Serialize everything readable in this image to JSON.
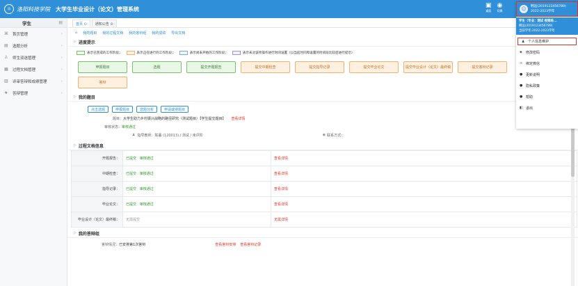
{
  "header": {
    "logo_glyph": "☼",
    "school_name": "洛阳科技学院",
    "system_title": "大学生毕业设计（论文）管理系统",
    "icons": [
      {
        "name": "monitor-icon",
        "glyph": "▣",
        "label": "桌面"
      },
      {
        "name": "globe-icon",
        "glyph": "◉",
        "label": "切换"
      }
    ]
  },
  "sidebar": {
    "role": "学生",
    "items": [
      {
        "name": "sidebar-item-home",
        "icon": "⌘",
        "label": "首页管理"
      },
      {
        "name": "sidebar-item-topic",
        "icon": "▤",
        "label": "选题分析"
      },
      {
        "name": "sidebar-item-choose",
        "icon": "♙",
        "label": "师生双选管理"
      },
      {
        "name": "sidebar-item-docs",
        "icon": "▦",
        "label": "过程文档管理"
      },
      {
        "name": "sidebar-item-review",
        "icon": "▥",
        "label": "评审答辩和成绩管理"
      },
      {
        "name": "sidebar-item-defense",
        "icon": "★",
        "label": "答辩管理"
      }
    ]
  },
  "tabs": [
    {
      "label": "首页 ⊙"
    },
    {
      "label": "通知公告 ⊙"
    }
  ],
  "links": [
    "我的题目",
    "我的过程文档",
    "我的答辩组",
    "我的成绩",
    "导出文档"
  ],
  "progress": {
    "title": "进度提示",
    "legend": [
      {
        "color": "#78c06a",
        "fill": "#e9f7e6",
        "text": "表示已完成的工作阶段；"
      },
      {
        "color": "#f0b070",
        "fill": "#fff0e0",
        "text": "表示正在进行的工作阶段；"
      },
      {
        "color": "#7aa7d8",
        "fill": "#eef4fb",
        "text": "表示尚未开始的工作阶段；"
      },
      {
        "color": "#a88fd0",
        "fill": "#f3effa",
        "text": "表示未对该项操作进行时间设置（以当前时间和设置的时间段比较后进行提示）"
      }
    ],
    "stages_row1": [
      {
        "label": "申报题目",
        "state": "done"
      },
      {
        "label": "选题",
        "state": "done"
      },
      {
        "label": "提交开题报告",
        "state": "done"
      },
      {
        "label": "提交中期检查",
        "state": "todo"
      },
      {
        "label": "提交指导记录",
        "state": "todo"
      },
      {
        "label": "提交毕业论文",
        "state": "todo"
      },
      {
        "label": "提交毕业设计（论文）最终稿",
        "state": "todo"
      },
      {
        "label": "提交答辩记录",
        "state": "todo"
      }
    ],
    "stages_row2": [
      {
        "label": "答辩",
        "state": "todo"
      }
    ]
  },
  "my_topic": {
    "title": "我的题目",
    "buttons": [
      "点击选题",
      "申报题目",
      "选题分析",
      "申请或待题目"
    ],
    "topic_label": "题目：",
    "topic_value": "大学生助力乡村振兴战略的路径研究（测试题目）【学生提交题目】",
    "topic_detail": "查看详情",
    "review_label": "审核状态：",
    "review_value": "审核通过",
    "teacher": "指导教师：陈暮 (120013) / 测试 / 未评阶",
    "contact": "联系方式："
  },
  "process_docs": {
    "title": "过程文档信息",
    "rows": [
      {
        "label": "开题报告：",
        "submitted": "已提交",
        "status": "审核通过",
        "action": "查看详情"
      },
      {
        "label": "中期检查：",
        "submitted": "已提交",
        "status": "审核通过",
        "action": "查看详情"
      },
      {
        "label": "指导记录：",
        "submitted": "已提交",
        "status": "审核通过",
        "action": "查看详情"
      },
      {
        "label": "毕业论文：",
        "submitted": "已提交",
        "status": "审核通过",
        "action": "查看详情"
      },
      {
        "label": "毕业设计（论文）最终稿：",
        "submitted": "无需提交",
        "status": "",
        "action": "无需详情"
      }
    ]
  },
  "defense": {
    "title": "我的答辩组",
    "label": "答辩情况：",
    "value": "已安排第1次答辩",
    "action1": "查看答辩安排",
    "action2": "查看答辩记录"
  },
  "user_menu": {
    "avatar_glyph": "☺",
    "user_line1": "韩远(2019123456789)",
    "user_line2": "2022-2023学年",
    "info_title": "学生（专业：测试 视频培...",
    "info_id": "韩远(2019123456789)",
    "info_term": "当前学年:2022-2023学年",
    "items": [
      {
        "name": "menu-item-profile",
        "icon": "♟",
        "label": "个人信息维护"
      },
      {
        "name": "menu-item-password",
        "icon": "◈",
        "label": "修改密码"
      },
      {
        "name": "menu-item-binding",
        "icon": "∞",
        "label": "绑定微信"
      },
      {
        "name": "menu-item-changelog",
        "icon": "●",
        "label": "更新说明"
      },
      {
        "name": "menu-item-privacy",
        "icon": "●",
        "label": "隐私政策"
      },
      {
        "name": "menu-item-help",
        "icon": "●",
        "label": "帮助"
      },
      {
        "name": "menu-item-logout",
        "icon": "◧",
        "label": "退出"
      }
    ]
  }
}
